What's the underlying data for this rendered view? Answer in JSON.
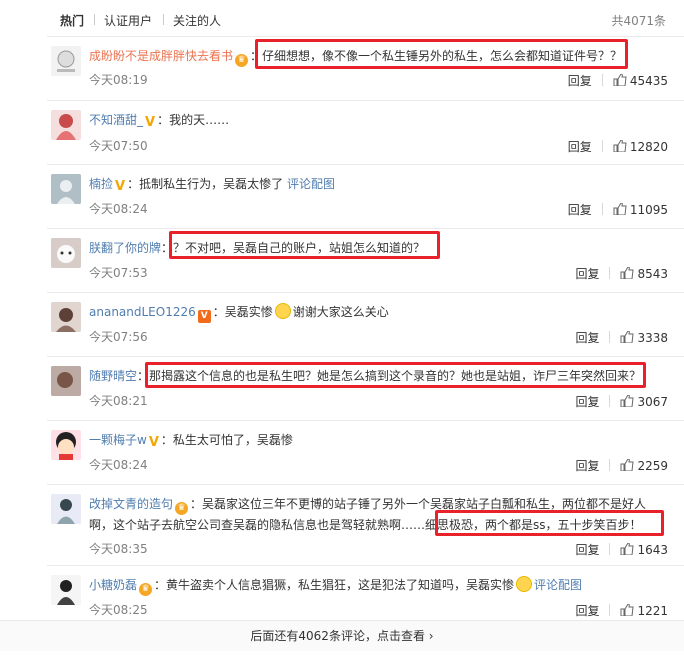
{
  "tabs": {
    "hot": "热门",
    "verified": "认证用户",
    "following": "关注的人",
    "total": "共4071条"
  },
  "comments": [
    {
      "user": "成盼盼不是成胖胖快去看书",
      "text": "仔细想想，像不像一个私生锤另外的私生，怎么会都知道证件号？？",
      "time": "今天08:19",
      "reply": "回复",
      "likes": "45435"
    },
    {
      "user": "不知酒甜_",
      "text": "我的天……",
      "time": "今天07:50",
      "reply": "回复",
      "likes": "12820"
    },
    {
      "user": "楠捡",
      "text": "抵制私生行为，吴磊太惨了",
      "link": "评论配图",
      "time": "今天08:24",
      "reply": "回复",
      "likes": "11095"
    },
    {
      "user": "朕翻了你的牌",
      "text": "？不对吧，吴磊自己的账户，站姐怎么知道的？",
      "time": "今天07:53",
      "reply": "回复",
      "likes": "8543"
    },
    {
      "user": "ananandLEO1226",
      "text": "吴磊实惨",
      "text2": "谢谢大家这么关心",
      "time": "今天07:56",
      "reply": "回复",
      "likes": "3338"
    },
    {
      "user": "随野晴空",
      "text": "那揭露这个信息的也是私生吧？她是怎么搞到这个录音的？她也是站姐，诈尸三年突然回来？",
      "time": "今天08:21",
      "reply": "回复",
      "likes": "3067"
    },
    {
      "user": "一颗梅子w",
      "text": "私生太可怕了，吴磊惨",
      "time": "今天08:24",
      "reply": "回复",
      "likes": "2259"
    },
    {
      "user": "改掉文青的造句",
      "text": "吴磊家这位三年不更博的站子锤了另外一个吴磊家站子白瓢和私生，两位都不是好人啊，这个站子去航空公司查吴磊的隐私信息也是驾轻就熟啊……",
      "text_hl": "细思极恐，两个都是ss，五十步笑百步！",
      "time": "今天08:35",
      "reply": "回复",
      "likes": "1643"
    },
    {
      "user": "小糖奶磊",
      "text": "黄牛盗卖个人信息猖獗，私生猖狂，这是犯法了知道吗，吴磊实惨",
      "link": "评论配图",
      "time": "今天08:25",
      "reply": "回复",
      "likes": "1221"
    }
  ],
  "footer": {
    "more": "后面还有4062条评论，点击查看"
  },
  "colors": {
    "highlight": "#e8212b",
    "username": "#eb7350",
    "link": "#507daf"
  }
}
